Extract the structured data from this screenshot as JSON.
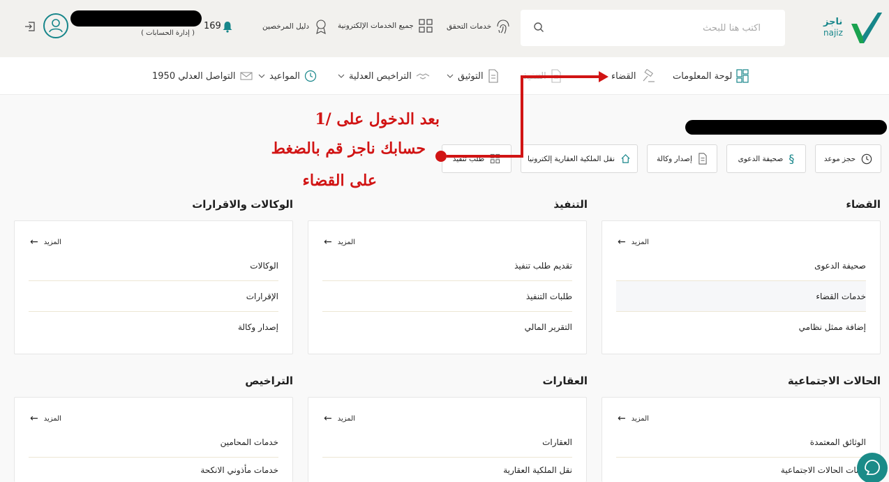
{
  "header": {
    "logo_arabic": "ناجز",
    "logo_latin": "najiz",
    "search_placeholder": "اكتب هنا للبحث",
    "links": [
      {
        "label": "خدمات التحقق",
        "icon": "fingerprint-icon"
      },
      {
        "label": "جميع الخدمات الإلكترونية",
        "icon": "grid-icon"
      },
      {
        "label": "دليل المرخصين",
        "icon": "badge-icon"
      }
    ],
    "notification_count": "169",
    "account_management": "( إدارة الحسابات )"
  },
  "nav": {
    "items": [
      {
        "label": "لوحة المعلومات",
        "icon": "dashboard-icon",
        "dropdown": false
      },
      {
        "label": "القضاء",
        "icon": "gavel-icon",
        "dropdown": false
      },
      {
        "label": "التنفيذ",
        "icon": "document-icon",
        "dropdown": false
      },
      {
        "label": "التوثيق",
        "icon": "document-icon",
        "dropdown": true
      },
      {
        "label": "التراخيص العدلية",
        "icon": "handshake-icon",
        "dropdown": true
      },
      {
        "label": "المواعيد",
        "icon": "clock-icon",
        "dropdown": true
      },
      {
        "label": "التواصل العدلي 1950",
        "icon": "mail-icon",
        "dropdown": false
      }
    ]
  },
  "quick_actions": [
    {
      "label": "حجز موعد",
      "icon": "clock-icon"
    },
    {
      "label": "صحيفة الدعوى",
      "icon": "section-icon"
    },
    {
      "label": "إصدار وكالة",
      "icon": "document-icon"
    },
    {
      "label": "نقل الملكية العقارية إلكترونيا",
      "icon": "home-icon"
    },
    {
      "label": "طلب تنفيذ",
      "icon": "grid-icon"
    }
  ],
  "annotation": {
    "line1": "1/ بعد الدخول على",
    "line2": "حسابك ناجز قم بالضغط",
    "line3": "على القضاء"
  },
  "more_label": "المزيد",
  "sections": [
    {
      "title": "القضاء",
      "items": [
        "صحيفة الدعوى",
        "خدمات القضاء",
        "إضافة ممثل نظامي"
      ]
    },
    {
      "title": "التنفيذ",
      "items": [
        "تقديم طلب تنفيذ",
        "طلبات التنفيذ",
        "التقرير المالي"
      ]
    },
    {
      "title": "الوكالات والاقرارات",
      "items": [
        "الوكالات",
        "الإقرارات",
        "إصدار وكالة"
      ]
    },
    {
      "title": "الحالات الاجتماعية",
      "items": [
        "الوثائق المعتمدة",
        "بيانات الحالات الاجتماعية"
      ]
    },
    {
      "title": "العقارات",
      "items": [
        "العقارات",
        "نقل الملكية العقارية"
      ]
    },
    {
      "title": "التراخيص",
      "items": [
        "خدمات المحامين",
        "خدمات مأذوني الانكحة"
      ]
    }
  ],
  "colors": {
    "brand_teal": "#17868a",
    "brand_green": "#1aa24f",
    "annotation_red": "#d11414"
  }
}
